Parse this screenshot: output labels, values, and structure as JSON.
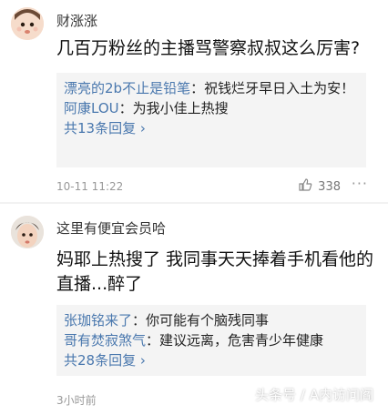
{
  "comments": [
    {
      "username": "财涨涨",
      "content": "几百万粉丝的主播骂警察叔叔这么厉害?",
      "replies": [
        {
          "name": "漂亮的2b不止是铅笔",
          "text": "：祝钱烂牙早日入土为安！"
        },
        {
          "name": "阿康LOU",
          "text": "：为我小佳上热搜"
        }
      ],
      "more_replies": "共13条回复 ›",
      "timestamp": "10-11 11:22",
      "likes": "338"
    },
    {
      "username": "这里有便宜会员哈",
      "content": "妈耶上热搜了 我同事天天捧着手机看他的直播...醉了",
      "replies": [
        {
          "name": "张珈铭来了",
          "text": "：你可能有个脑残同事"
        },
        {
          "name": "哥有焚寂煞气",
          "text": "：建议远离，危害青少年健康"
        }
      ],
      "more_replies": "共28条回复 ›",
      "timestamp": "3小时前"
    }
  ],
  "watermark": "头条号 / A内访问阎",
  "icons": {
    "like": "thumbs-up-icon",
    "more": "more-dots-icon"
  },
  "colors": {
    "reply_name": "#4a78ae",
    "reply_box": "#f4f4f4"
  }
}
